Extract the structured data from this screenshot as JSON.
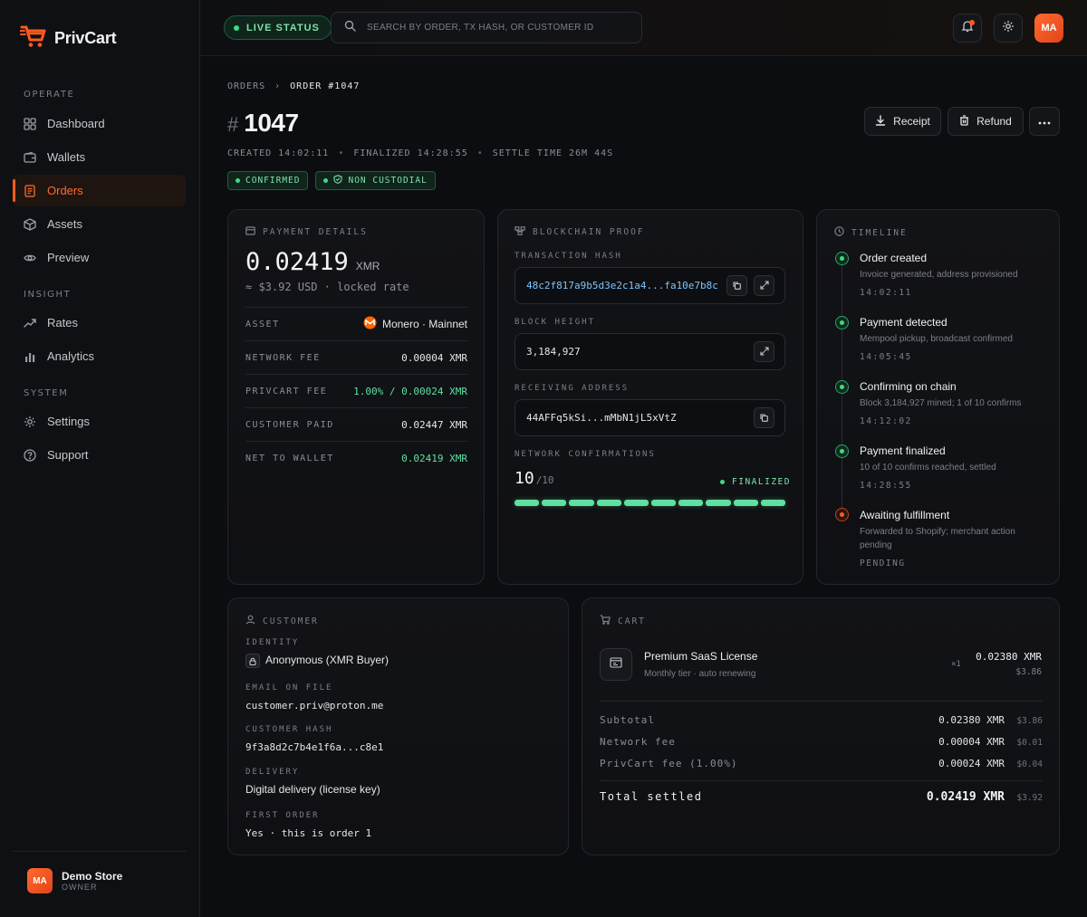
{
  "brand": {
    "name": "PrivCart"
  },
  "sidebar": {
    "sections": [
      "OPERATE",
      "INSIGHT",
      "SYSTEM"
    ],
    "items": [
      {
        "label": "Dashboard",
        "icon": "grid-icon"
      },
      {
        "label": "Wallets",
        "icon": "wallet-icon"
      },
      {
        "label": "Orders",
        "icon": "document-icon",
        "active": true
      },
      {
        "label": "Assets",
        "icon": "cube-icon"
      },
      {
        "label": "Preview",
        "icon": "eye-icon"
      },
      {
        "label": "Rates",
        "icon": "trend-icon"
      },
      {
        "label": "Analytics",
        "icon": "bar-chart-icon"
      },
      {
        "label": "Settings",
        "icon": "gear-icon"
      },
      {
        "label": "Support",
        "icon": "help-icon"
      }
    ],
    "user": {
      "initials": "MA",
      "name": "Demo Store",
      "role": "OWNER"
    }
  },
  "topbar": {
    "live_label": "LIVE STATUS",
    "search_placeholder": "SEARCH BY ORDER, TX HASH, OR CUSTOMER ID",
    "avatar_initials": "MA"
  },
  "breadcrumb": [
    "ORDERS",
    "ORDER #1047"
  ],
  "order": {
    "hash": "#",
    "number": "1047",
    "created": "CREATED 14:02:11",
    "finalized": "FINALIZED 14:28:55",
    "settle": "SETTLE TIME 26M 44S",
    "badges": [
      "CONFIRMED",
      "NON CUSTODIAL"
    ]
  },
  "actions": {
    "receipt": "Receipt",
    "refund": "Refund"
  },
  "payment": {
    "title": "PAYMENT DETAILS",
    "amount": "0.02419",
    "unit": "XMR",
    "usd": "≈ $3.92 USD · locked rate",
    "rows": [
      {
        "k": "ASSET",
        "v": "Monero · Mainnet"
      },
      {
        "k": "NETWORK FEE",
        "v": "0.00004 XMR"
      },
      {
        "k": "PRIVCART FEE",
        "v": "1.00% / 0.00024 XMR"
      },
      {
        "k": "CUSTOMER PAID",
        "v": "0.02447 XMR"
      },
      {
        "k": "NET TO WALLET",
        "v": "0.02419 XMR"
      }
    ]
  },
  "proof": {
    "title": "BLOCKCHAIN PROOF",
    "tx_label": "TRANSACTION HASH",
    "tx_hash": "48c2f817a9b5d3e2c1a4...fa10e7b8c",
    "height_label": "BLOCK HEIGHT",
    "height": "3,184,927",
    "addr_label": "RECEIVING ADDRESS",
    "addr": "44AFFq5kSi...mMbN1jL5xVtZ",
    "conf_label": "NETWORK CONFIRMATIONS",
    "conf_count": "10",
    "conf_total": "/10",
    "conf_status": "FINALIZED",
    "confirmations": 10,
    "required": 10
  },
  "timeline": {
    "title": "TIMELINE",
    "events": [
      {
        "title": "Order created",
        "desc": "Invoice generated, address provisioned",
        "time": "14:02:11"
      },
      {
        "title": "Payment detected",
        "desc": "Mempool pickup, broadcast confirmed",
        "time": "14:05:45"
      },
      {
        "title": "Confirming on chain",
        "desc": "Block 3,184,927 mined; 1 of 10 confirms",
        "time": "14:12:02"
      },
      {
        "title": "Payment finalized",
        "desc": "10 of 10 confirms reached, settled",
        "time": "14:28:55"
      },
      {
        "title": "Awaiting fulfillment",
        "desc": "Forwarded to Shopify; merchant action pending",
        "time": "PENDING"
      }
    ]
  },
  "customer": {
    "title": "CUSTOMER",
    "identity_label": "IDENTITY",
    "identity": "Anonymous (XMR Buyer)",
    "email_label": "EMAIL ON FILE",
    "email": "customer.priv@proton.me",
    "hash_label": "CUSTOMER HASH",
    "hash": "9f3a8d2c7b4e1f6a...c8e1",
    "delivery_label": "DELIVERY",
    "delivery": "Digital delivery (license key)",
    "first_label": "FIRST ORDER",
    "first": "Yes · this is order 1"
  },
  "cart": {
    "title": "CART",
    "product": {
      "name": "Premium SaaS License",
      "sub": "Monthly tier · auto renewing",
      "qty": "×1",
      "price": "0.02380 XMR",
      "usd": "$3.86"
    },
    "rows": [
      {
        "k": "Subtotal",
        "v": "0.02380 XMR",
        "u": "$3.86"
      },
      {
        "k": "Network fee",
        "v": "0.00004 XMR",
        "u": "$0.01"
      },
      {
        "k": "PrivCart fee (1.00%)",
        "v": "0.00024 XMR",
        "u": "$0.04"
      }
    ],
    "total": {
      "k": "Total settled",
      "v": "0.02419 XMR",
      "u": "$3.92"
    }
  },
  "colors": {
    "accent": "#ff5a1f",
    "success": "#3ddc84",
    "link": "#7cc4ff"
  }
}
